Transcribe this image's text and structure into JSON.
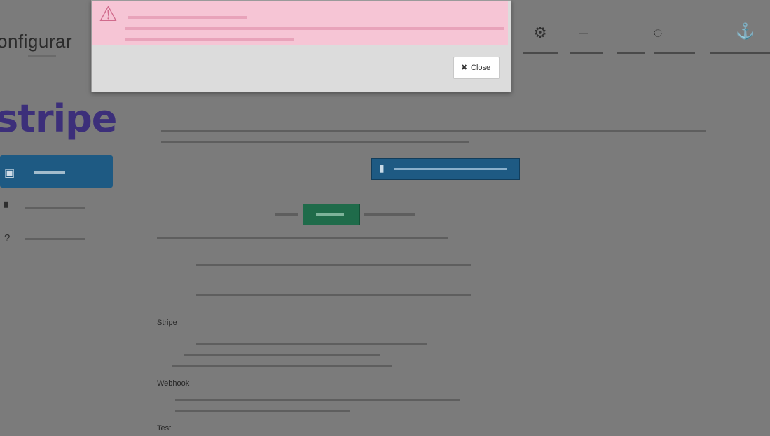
{
  "header": {
    "brand": "onfigurar",
    "nav": [
      {
        "icon": "gear-icon",
        "glyph": "⚙"
      },
      {
        "icon": "menu-icon",
        "glyph": "—"
      },
      {
        "icon": "globe-icon",
        "glyph": "◌"
      },
      {
        "icon": "refresh-icon",
        "glyph": "⟳"
      },
      {
        "icon": "anchor-icon",
        "glyph": "⚓"
      }
    ]
  },
  "stripe": {
    "logo": "stripe"
  },
  "sidebar": {
    "active_icon": "settings-icon",
    "items": [
      {
        "icon": "document-icon"
      },
      {
        "icon": "help-icon"
      }
    ]
  },
  "content": {
    "section_payment": "Stripe",
    "section_webhooks": "Webhook",
    "section_test": "Test"
  },
  "modal": {
    "close_label": "Close"
  }
}
